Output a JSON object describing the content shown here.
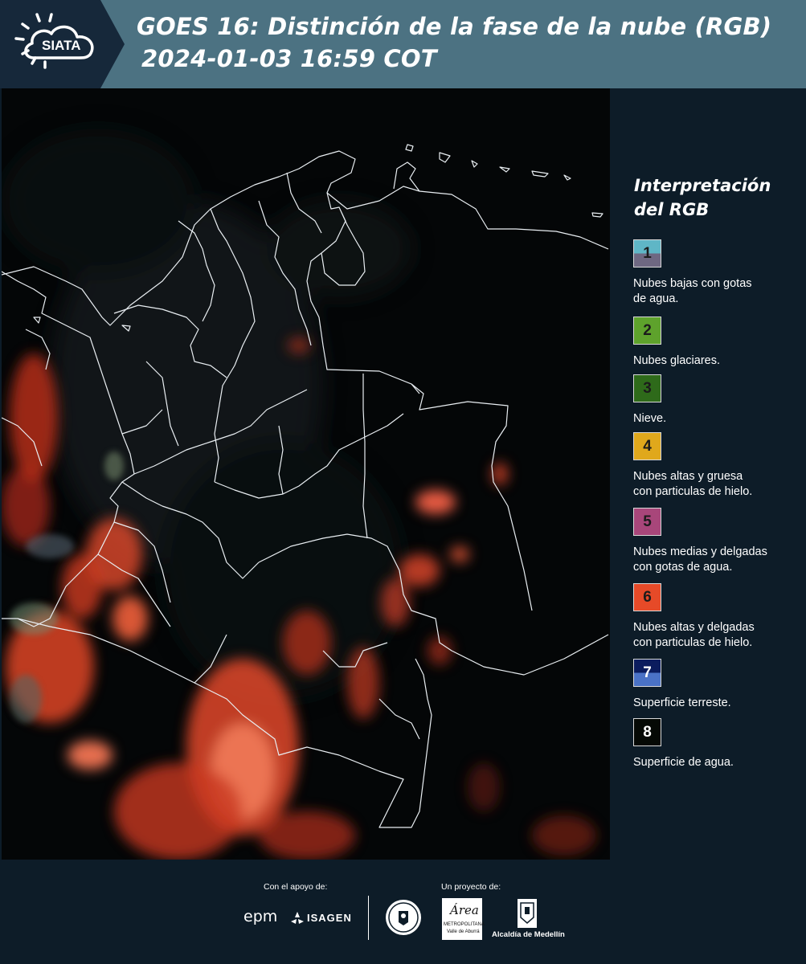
{
  "header": {
    "logo_text": "SIATA",
    "title_line1": "GOES 16: Distinción de la fase de la nube (RGB)",
    "title_line2": "2024-01-03 16:59 COT"
  },
  "legend": {
    "title_line1": "Interpretación",
    "title_line2": "del RGB",
    "items": [
      {
        "number": "1",
        "label_line1": "Nubes bajas con gotas",
        "label_line2": "de agua.",
        "color_top": "#5fb6c6",
        "color_bottom": "#6e6882"
      },
      {
        "number": "2",
        "label_line1": "Nubes glaciares.",
        "label_line2": "",
        "color_top": "#5ea22c",
        "color_bottom": "#5ea22c"
      },
      {
        "number": "3",
        "label_line1": "Nieve.",
        "label_line2": "",
        "color_top": "#2e6a1a",
        "color_bottom": "#2e6a1a"
      },
      {
        "number": "4",
        "label_line1": "Nubes altas y gruesa",
        "label_line2": "con particulas de hielo.",
        "color_top": "#e0a81c",
        "color_bottom": "#e0a81c"
      },
      {
        "number": "5",
        "label_line1": "Nubes medias y delgadas",
        "label_line2": "con gotas de agua.",
        "color_top": "#a8467a",
        "color_bottom": "#a8467a"
      },
      {
        "number": "6",
        "label_line1": "Nubes altas y delgadas",
        "label_line2": "con particulas de hielo.",
        "color_top": "#e64a28",
        "color_bottom": "#e64a28"
      },
      {
        "number": "7",
        "label_line1": "Superficie terreste.",
        "label_line2": "",
        "color_top": "#0b1c5e",
        "color_bottom": "#4a72c6"
      },
      {
        "number": "8",
        "label_line1": "Superficie de agua.",
        "label_line2": "",
        "color_top": "#050905",
        "color_bottom": "#050905"
      }
    ]
  },
  "footer": {
    "support_label": "Con el apoyo de:",
    "project_label": "Un proyecto de:",
    "partner_epm": "epm",
    "partner_isagen": "ISAGEN",
    "partner_area_name": "Área",
    "partner_area_sub1": "METROPOLITANA",
    "partner_area_sub2": "Valle de Aburrá",
    "partner_alcaldia": "Alcaldía de Medellín"
  }
}
